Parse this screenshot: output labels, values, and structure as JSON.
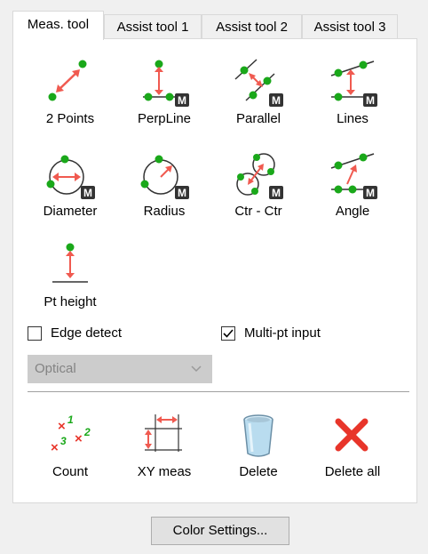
{
  "tabs": [
    "Meas. tool",
    "Assist tool 1",
    "Assist tool 2",
    "Assist tool 3"
  ],
  "tools": {
    "two_points": "2 Points",
    "perpline": "PerpLine",
    "parallel": "Parallel",
    "lines": "Lines",
    "diameter": "Diameter",
    "radius": "Radius",
    "ctr_ctr": "Ctr - Ctr",
    "angle": "Angle",
    "pt_height": "Pt height"
  },
  "badge": "M",
  "options": {
    "edge_detect": {
      "label": "Edge detect",
      "checked": false
    },
    "multi_pt": {
      "label": "Multi-pt input",
      "checked": true
    }
  },
  "mode_select": {
    "value": "Optical"
  },
  "actions": {
    "count": "Count",
    "xy_meas": "XY meas",
    "delete": "Delete",
    "delete_all": "Delete all"
  },
  "count_icon_digits": [
    "1",
    "2",
    "3"
  ],
  "color_settings_label": "Color Settings...",
  "colors": {
    "accent_red": "#f05a50",
    "point_green": "#1aa81a",
    "delete_red": "#e8352a"
  }
}
